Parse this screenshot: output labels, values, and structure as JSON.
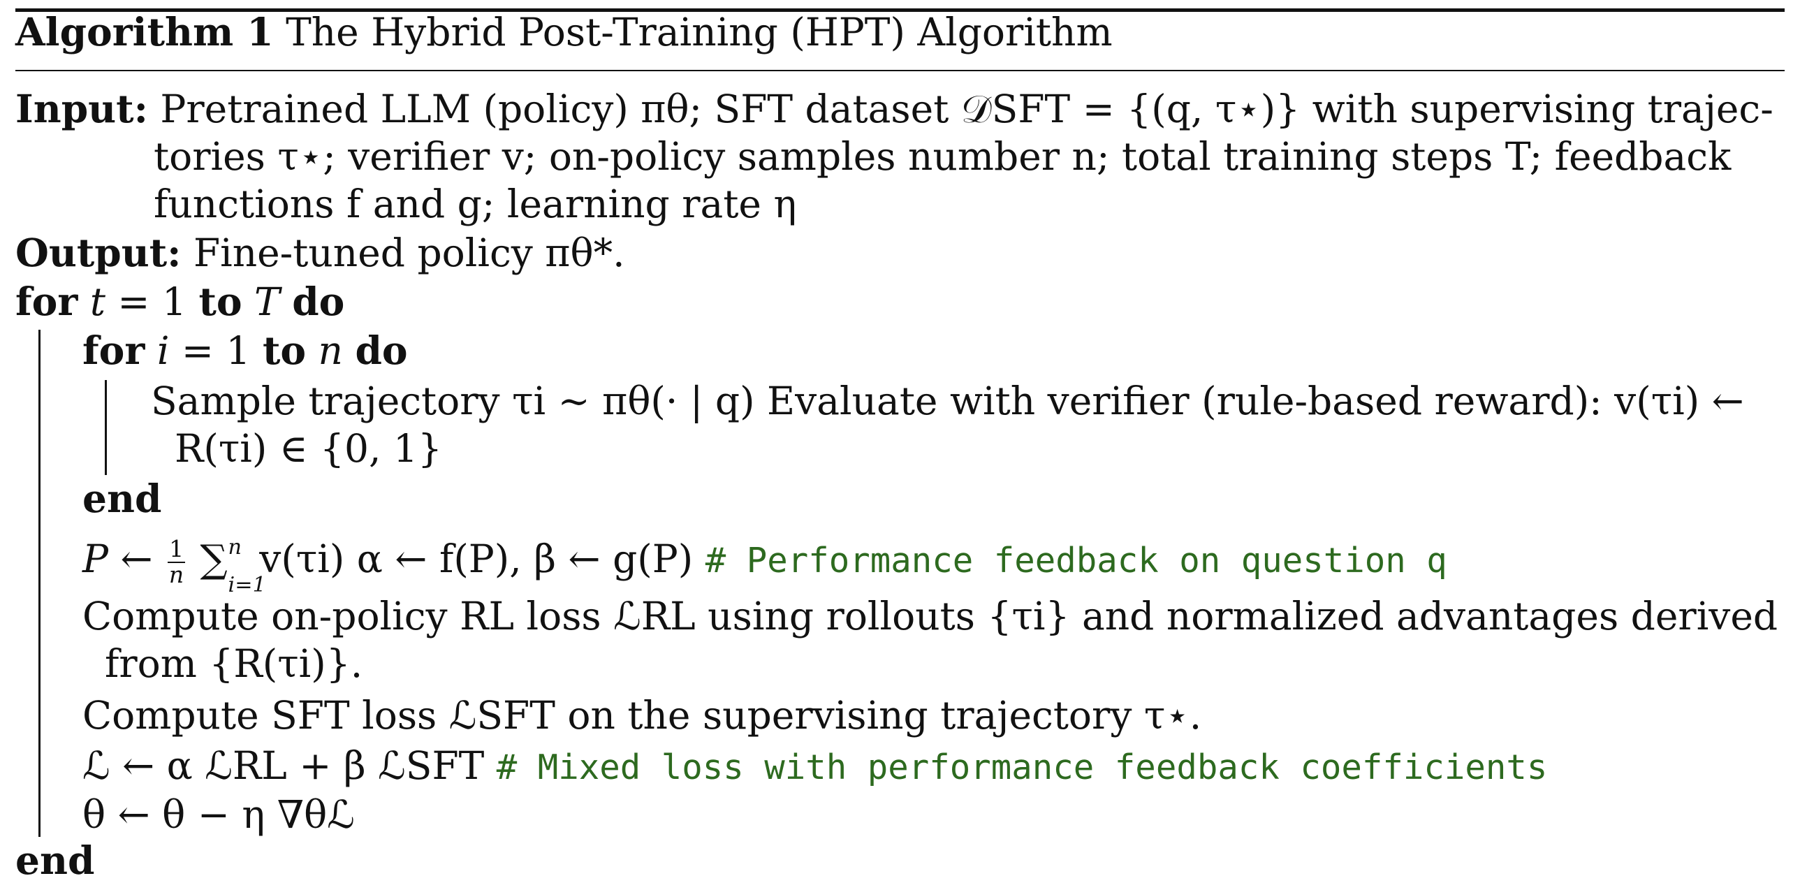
{
  "algorithm": {
    "label": "Algorithm 1",
    "title": "The Hybrid Post-Training (HPT) Algorithm"
  },
  "input": {
    "label": "Input:",
    "line1": "Pretrained LLM (policy) πθ; SFT dataset 𝒟SFT = {(q, τ⋆)} with supervising trajec-",
    "line2": "tories τ⋆; verifier v; on-policy samples number n; total training steps T; feedback",
    "line3": "functions f and g; learning rate η"
  },
  "output": {
    "label": "Output:",
    "text": "Fine-tuned policy πθ*."
  },
  "loop_outer": {
    "kw_for": "for",
    "var": "t",
    "eq": "= 1",
    "kw_to": "to",
    "bound": "T",
    "kw_do": "do"
  },
  "loop_inner": {
    "kw_for": "for",
    "var": "i",
    "eq": "= 1",
    "kw_to": "to",
    "bound": "n",
    "kw_do": "do"
  },
  "inner_body": {
    "line1": "Sample trajectory τi ∼ πθ(· | q)  Evaluate with verifier (rule-based reward):   v(τi) ←",
    "line2": "R(τi) ∈ {0, 1}"
  },
  "end_inner": "end",
  "feedback": {
    "lhs": "P ←",
    "frac_num": "1",
    "frac_den": "n",
    "sum": "∑",
    "sum_up": "n",
    "sum_lo": "i=1",
    "rest": "v(τi)  α ← f(P),    β ← g(P)",
    "comment": "# Performance feedback on question q"
  },
  "rl_loss": {
    "line1": "Compute on-policy RL loss ℒRL using rollouts {τi} and normalized advantages derived",
    "line2": "from {R(τi)}."
  },
  "sft_loss": "Compute SFT loss ℒSFT on the supervising trajectory τ⋆.",
  "mixed": {
    "expr": "ℒ ← α ℒRL + β ℒSFT",
    "comment": "# Mixed loss with performance feedback coefficients"
  },
  "update": "θ ← θ − η ∇θℒ",
  "end_outer": "end"
}
